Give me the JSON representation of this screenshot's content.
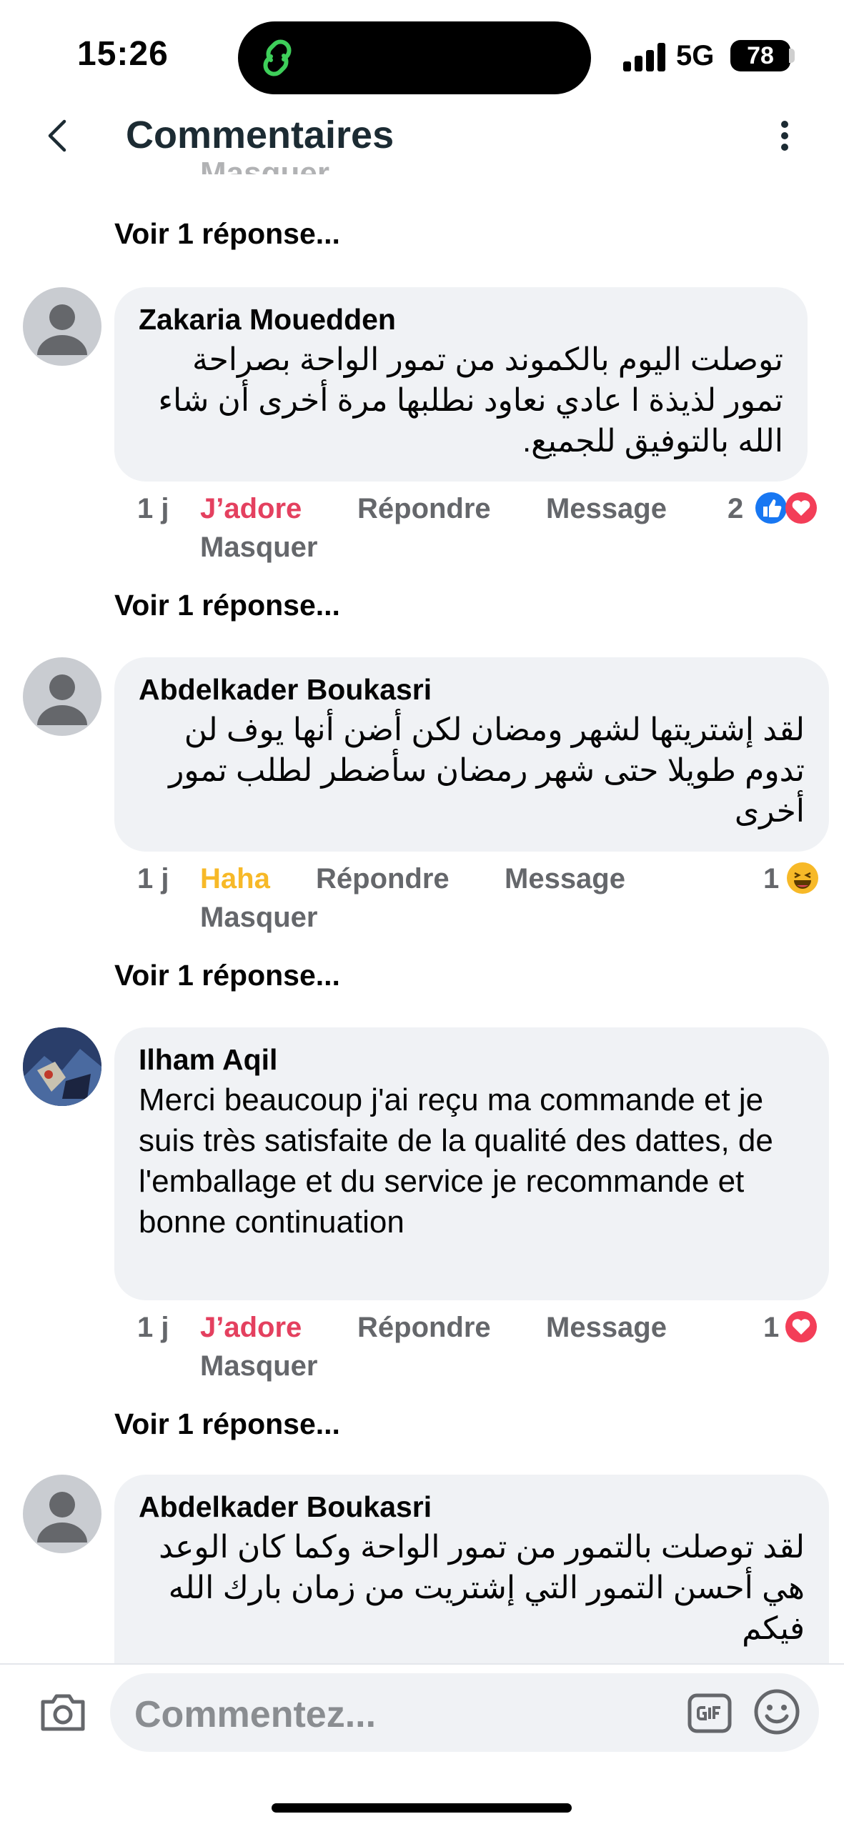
{
  "status_bar": {
    "time": "15:26",
    "network": "5G",
    "battery": "78"
  },
  "header": {
    "title": "Commentaires"
  },
  "partial_text": "Masquer",
  "comments": [
    {
      "author": "Zakaria Mouedden",
      "text": "توصلت اليوم بالكموند  من تمور  الواحة  بصراحة تمور لذيذة ا عادي نعاود نطلبها مرة أخرى أن شاء الله بالتوفيق للجميع.",
      "time": "1 j",
      "reaction_label": "J’adore",
      "reply_label": "Répondre",
      "message_label": "Message",
      "hide_label": "Masquer",
      "reaction_count": "2",
      "reaction_icons": [
        "like-icon",
        "love-icon"
      ],
      "replies_link": "Voir 1 réponse..."
    },
    {
      "author": "Abdelkader Boukasri",
      "text": "لقد إشتريتها لشهر ومضان لكن أضن أنها يوف لن تدوم طويلا حتى شهر رمضان سأضطر لطلب تمور أخرى",
      "time": "1 j",
      "reaction_label": "Haha",
      "reply_label": "Répondre",
      "message_label": "Message",
      "hide_label": "Masquer",
      "reaction_count": "1",
      "reaction_icons": [
        "haha-icon"
      ],
      "replies_link": "Voir 1 réponse..."
    },
    {
      "author": "Ilham Aqil",
      "text": "Merci beaucoup j'ai reçu ma commande et je suis très satisfaite de la qualité des dattes, de l'emballage et du service je recommande et bonne continuation",
      "time": "1 j",
      "reaction_label": "J’adore",
      "reply_label": "Répondre",
      "message_label": "Message",
      "hide_label": "Masquer",
      "reaction_count": "1",
      "reaction_icons": [
        "love-icon"
      ],
      "replies_link": "Voir 1 réponse..."
    },
    {
      "author": "Abdelkader Boukasri",
      "text": "لقد توصلت بالتمور من تمور الواحة وكما كان الوعد هي  أحسن التمور التي إشتريت من زمان بارك الله فيكم"
    }
  ],
  "top_replies_link": "Voir 1 réponse...",
  "composer": {
    "placeholder": "Commentez..."
  },
  "colors": {
    "love": "#e4405f",
    "haha": "#f7b928",
    "like": "#1877f2",
    "bubble": "#f0f2f5",
    "muted": "#65676b"
  }
}
